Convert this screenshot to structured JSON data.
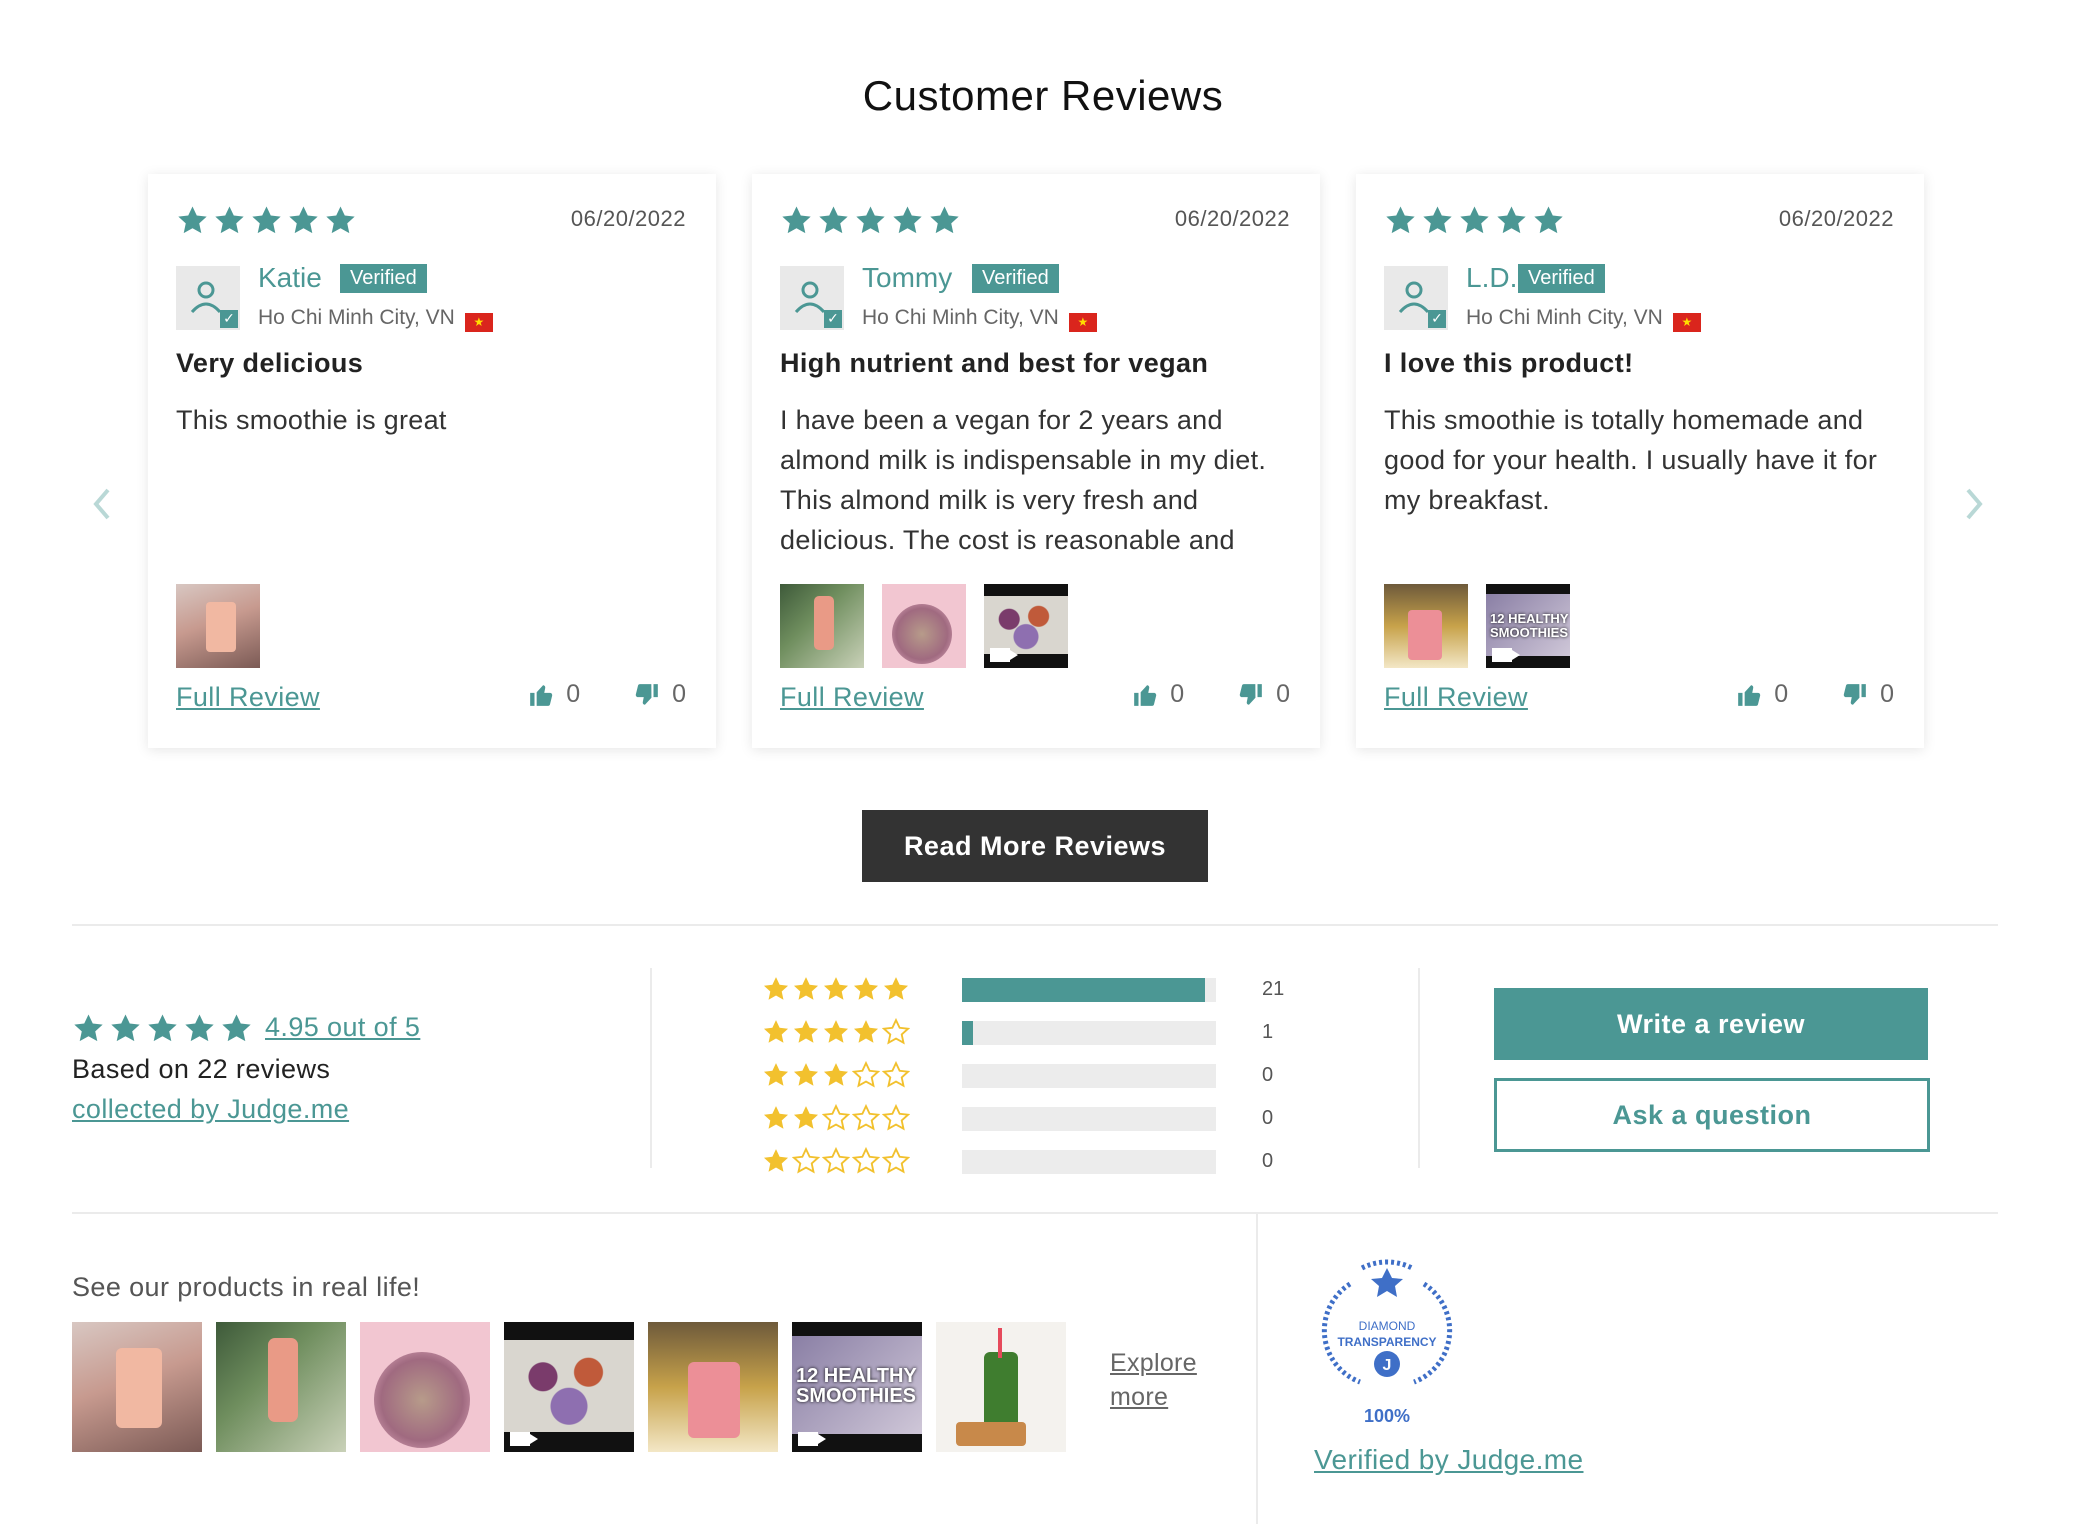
{
  "section_title": "Customer Reviews",
  "colors": {
    "accent": "#4b9794",
    "star_yellow": "#f2c12e",
    "dark_button": "#333333"
  },
  "reviews": [
    {
      "rating": 5,
      "date": "06/20/2022",
      "name": "Katie",
      "verified": "Verified",
      "location": "Ho Chi Minh City, VN",
      "title": "Very delicious",
      "body": "This smoothie is great",
      "full_review": "Full Review",
      "up": "0",
      "down": "0"
    },
    {
      "rating": 5,
      "date": "06/20/2022",
      "name": "Tommy",
      "verified": "Verified",
      "location": "Ho Chi Minh City, VN",
      "title": "High nutrient and best for vegan",
      "body": "I have been a vegan for 2 years and almond milk is indispensable in my diet. This almond milk is very fresh and delicious. The cost is reasonable and",
      "full_review": "Full Review",
      "up": "0",
      "down": "0"
    },
    {
      "rating": 5,
      "date": "06/20/2022",
      "name": "L.D.",
      "verified": "Verified",
      "location": "Ho Chi Minh City, VN",
      "title": "I love this product!",
      "body": "This smoothie is totally homemade and good for your health. I usually have it for my breakfast.",
      "full_review": "Full Review",
      "up": "0",
      "down": "0"
    }
  ],
  "thumb_overlay_text": "12 HEALTHY SMOOTHIES",
  "read_more": "Read More Reviews",
  "summary": {
    "average": "4.95 out of 5",
    "based_on": "Based on 22 reviews",
    "collected_by": "collected by Judge.me"
  },
  "histogram": [
    {
      "stars": 5,
      "count": "21",
      "fraction": 0.955
    },
    {
      "stars": 4,
      "count": "1",
      "fraction": 0.045
    },
    {
      "stars": 3,
      "count": "0",
      "fraction": 0
    },
    {
      "stars": 2,
      "count": "0",
      "fraction": 0
    },
    {
      "stars": 1,
      "count": "0",
      "fraction": 0
    }
  ],
  "actions": {
    "write": "Write a review",
    "ask": "Ask a question"
  },
  "gallery": {
    "heading": "See our products in real life!",
    "explore": "Explore more"
  },
  "badge": {
    "line1": "DIAMOND",
    "line2": "TRANSPARENCY",
    "percent": "100%",
    "verified_by": "Verified by Judge.me"
  }
}
